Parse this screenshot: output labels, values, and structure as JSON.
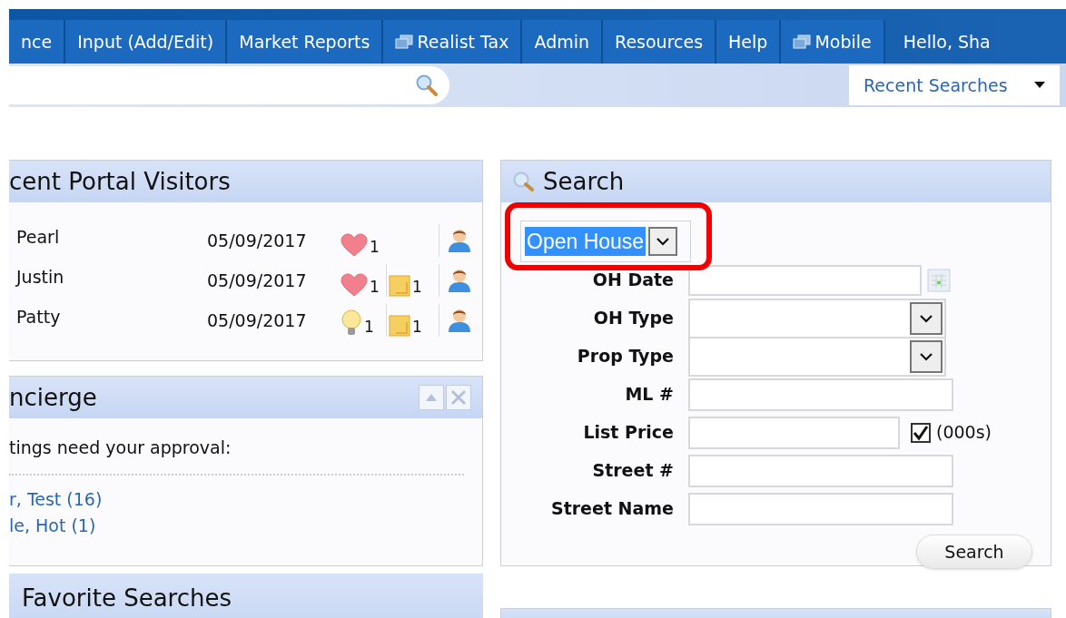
{
  "nav": {
    "tabs": [
      {
        "label": "nce",
        "has_icon": false
      },
      {
        "label": "Input (Add/Edit)",
        "has_icon": false
      },
      {
        "label": "Market Reports",
        "has_icon": false
      },
      {
        "label": "Realist Tax",
        "has_icon": true
      },
      {
        "label": "Admin",
        "has_icon": false
      },
      {
        "label": "Resources",
        "has_icon": false
      },
      {
        "label": "Help",
        "has_icon": false
      },
      {
        "label": "Mobile",
        "has_icon": true
      }
    ],
    "greeting": "Hello, Sha"
  },
  "toolbar": {
    "recent_searches": "Recent Searches"
  },
  "visitors": {
    "title": "cent Portal Visitors",
    "rows": [
      {
        "name": "Pearl",
        "date": "05/09/2017",
        "badges": [
          {
            "kind": "heart",
            "count": "1"
          }
        ]
      },
      {
        "name": "Justin",
        "date": "05/09/2017",
        "badges": [
          {
            "kind": "heart",
            "count": "1"
          },
          {
            "kind": "note",
            "count": "1"
          }
        ]
      },
      {
        "name": "Patty",
        "date": "05/09/2017",
        "badges": [
          {
            "kind": "bulb",
            "count": "1"
          },
          {
            "kind": "note",
            "count": "1"
          }
        ]
      }
    ]
  },
  "concierge": {
    "title": "ncierge",
    "message": "tings need your approval:",
    "links": [
      "r, Test (16)",
      "le, Hot (1)"
    ]
  },
  "favorites": {
    "title": "Favorite Searches"
  },
  "search": {
    "title": "Search",
    "search_type": "Open House",
    "fields": [
      {
        "label": "OH Date",
        "kind": "date"
      },
      {
        "label": "OH Type",
        "kind": "select"
      },
      {
        "label": "Prop Type",
        "kind": "select"
      },
      {
        "label": "ML #",
        "kind": "text"
      },
      {
        "label": "List Price",
        "kind": "price",
        "checked": true,
        "suffix": "(000s)"
      },
      {
        "label": "Street #",
        "kind": "text"
      },
      {
        "label": "Street Name",
        "kind": "text"
      }
    ],
    "button": "Search"
  }
}
